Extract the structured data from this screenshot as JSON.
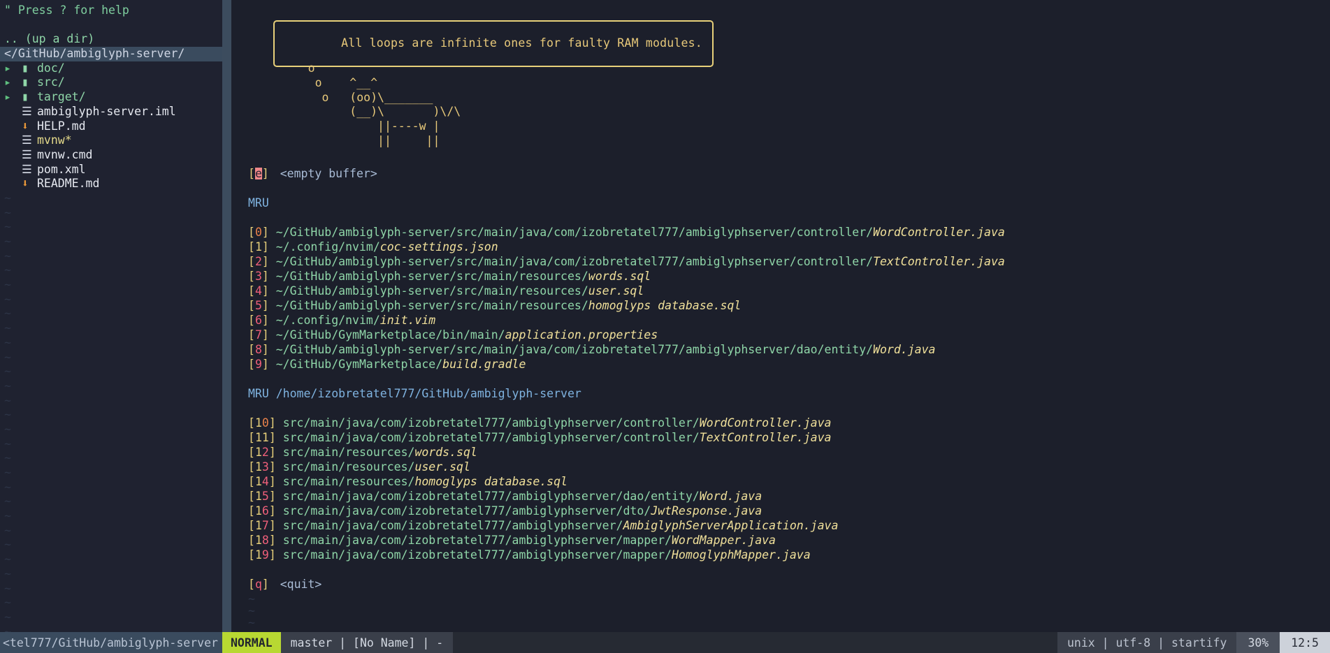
{
  "sidebar": {
    "help_line": "\" Press ? for help",
    "up_a_dir": ".. (up a dir)",
    "current_dir": "</GitHub/ambiglyph-server/",
    "entries": [
      {
        "arrow": "▸",
        "icon": "folder-icon",
        "glyph": "▮",
        "label": "doc/",
        "kind": "dir"
      },
      {
        "arrow": "▸",
        "icon": "folder-icon",
        "glyph": "▮",
        "label": "src/",
        "kind": "dir"
      },
      {
        "arrow": "▸",
        "icon": "folder-icon",
        "glyph": "▮",
        "label": "target/",
        "kind": "dir"
      },
      {
        "arrow": "",
        "icon": "file-icon",
        "glyph": "☰",
        "label": "ambiglyph-server.iml",
        "kind": "file"
      },
      {
        "arrow": "",
        "icon": "markdown-icon",
        "glyph": "⬇",
        "label": "HELP.md",
        "kind": "md"
      },
      {
        "arrow": "",
        "icon": "file-icon",
        "glyph": "☰",
        "label": "mvnw*",
        "kind": "exec"
      },
      {
        "arrow": "",
        "icon": "file-icon",
        "glyph": "☰",
        "label": "mvnw.cmd",
        "kind": "file"
      },
      {
        "arrow": "",
        "icon": "file-icon",
        "glyph": "☰",
        "label": "pom.xml",
        "kind": "file"
      },
      {
        "arrow": "",
        "icon": "markdown-icon",
        "glyph": "⬇",
        "label": "README.md",
        "kind": "md"
      }
    ],
    "filler": "~",
    "filler_count": 31
  },
  "startify": {
    "quote": "All loops are infinite ones for faulty RAM modules.",
    "cow_art": "     o\n      o    ^__^\n       o   (oo)\\_______\n           (__)\\       )\\/\\\n               ||----w |\n               ||     ||",
    "empty_buffer": {
      "key": "e",
      "label": "<empty buffer>"
    },
    "section1_header": "MRU",
    "section2_header": "MRU /home/izobretatel777/GitHub/ambiglyph-server",
    "quit": {
      "key": "q",
      "label": "<quit>"
    },
    "mru": [
      {
        "index": "0",
        "dir": "~/GitHub/ambiglyph-server/src/main/java/com/izobretatel777/ambiglyphserver/controller/",
        "file": "WordController.java"
      },
      {
        "index": "1",
        "dir": "~/.config/nvim/",
        "file": "coc-settings.json"
      },
      {
        "index": "2",
        "dir": "~/GitHub/ambiglyph-server/src/main/java/com/izobretatel777/ambiglyphserver/controller/",
        "file": "TextController.java"
      },
      {
        "index": "3",
        "dir": "~/GitHub/ambiglyph-server/src/main/resources/",
        "file": "words.sql"
      },
      {
        "index": "4",
        "dir": "~/GitHub/ambiglyph-server/src/main/resources/",
        "file": "user.sql"
      },
      {
        "index": "5",
        "dir": "~/GitHub/ambiglyph-server/src/main/resources/",
        "file": "homoglyps database.sql"
      },
      {
        "index": "6",
        "dir": "~/.config/nvim/",
        "file": "init.vim"
      },
      {
        "index": "7",
        "dir": "~/GitHub/GymMarketplace/bin/main/",
        "file": "application.properties"
      },
      {
        "index": "8",
        "dir": "~/GitHub/ambiglyph-server/src/main/java/com/izobretatel777/ambiglyphserver/dao/entity/",
        "file": "Word.java"
      },
      {
        "index": "9",
        "dir": "~/GitHub/GymMarketplace/",
        "file": "build.gradle"
      }
    ],
    "mru_local": [
      {
        "index": "10",
        "dir": "src/main/java/com/izobretatel777/ambiglyphserver/controller/",
        "file": "WordController.java"
      },
      {
        "index": "11",
        "dir": "src/main/java/com/izobretatel777/ambiglyphserver/controller/",
        "file": "TextController.java"
      },
      {
        "index": "12",
        "dir": "src/main/resources/",
        "file": "words.sql"
      },
      {
        "index": "13",
        "dir": "src/main/resources/",
        "file": "user.sql"
      },
      {
        "index": "14",
        "dir": "src/main/resources/",
        "file": "homoglyps database.sql"
      },
      {
        "index": "15",
        "dir": "src/main/java/com/izobretatel777/ambiglyphserver/dao/entity/",
        "file": "Word.java"
      },
      {
        "index": "16",
        "dir": "src/main/java/com/izobretatel777/ambiglyphserver/dto/",
        "file": "JwtResponse.java"
      },
      {
        "index": "17",
        "dir": "src/main/java/com/izobretatel777/ambiglyphserver/",
        "file": "AmbiglyphServerApplication.java"
      },
      {
        "index": "18",
        "dir": "src/main/java/com/izobretatel777/ambiglyphserver/mapper/",
        "file": "WordMapper.java"
      },
      {
        "index": "19",
        "dir": "src/main/java/com/izobretatel777/ambiglyphserver/mapper/",
        "file": "HomoglyphMapper.java"
      }
    ],
    "filler": "~"
  },
  "statusline": {
    "tree_path": "<tel777/GitHub/ambiglyph-server",
    "mode": "NORMAL",
    "branch_info": "master | [No Name] | -",
    "file_format": "unix | utf-8 | startify",
    "percent": "30%",
    "position": "12:5"
  },
  "colors": {
    "bg": "#1c1f2b",
    "sidebar_bg": "#1f2230",
    "split": "#3c4c5e",
    "green": "#8fd6a8",
    "yellow": "#e8d07a",
    "file_yellow": "#f0e09a",
    "red": "#ef5f7a",
    "orange": "#e8814a",
    "blue": "#7fb3e0",
    "mode_green": "#b8d832",
    "select_bg": "#3a4b5e"
  }
}
